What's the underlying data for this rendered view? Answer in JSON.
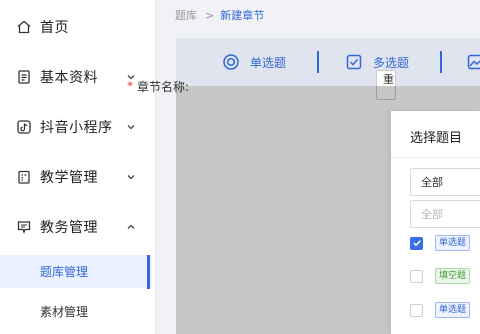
{
  "sidebar": {
    "items": [
      {
        "label": "首页",
        "icon": "home-icon"
      },
      {
        "label": "基本资料",
        "icon": "document-icon",
        "arrow": "chevron-down"
      },
      {
        "label": "抖音小程序",
        "icon": "tiktok-icon",
        "arrow": "chevron-down"
      },
      {
        "label": "教学管理",
        "icon": "clipboard-icon",
        "arrow": "chevron-down"
      },
      {
        "label": "教务管理",
        "icon": "comment-icon",
        "arrow": "chevron-up"
      }
    ],
    "sub_items": [
      {
        "label": "题库管理",
        "active": true
      },
      {
        "label": "素材管理",
        "active": false
      }
    ]
  },
  "breadcrumb": {
    "parent": "题库",
    "separator": ">",
    "current": "新建章节"
  },
  "toolbar": {
    "buttons": [
      {
        "label": "单选题",
        "icon": "radio-icon"
      },
      {
        "label": "多选题",
        "icon": "checkbox-icon"
      },
      {
        "label": "",
        "icon": "image-icon"
      }
    ]
  },
  "form": {
    "required_mark": "*",
    "chapter_label": "章节名称:",
    "chapter_value": "重"
  },
  "dialog": {
    "title": "选择题目",
    "filter_value": "全部",
    "filter2_placeholder": "全部",
    "questions": [
      {
        "checked": true,
        "tag": "单选题",
        "tag_color": "blue"
      },
      {
        "checked": false,
        "tag": "填空题",
        "tag_color": "green"
      },
      {
        "checked": false,
        "tag": "单选题",
        "tag_color": "blue"
      }
    ]
  },
  "colors": {
    "accent": "#3466d8",
    "required": "#e53935",
    "overlay": "rgba(0,0,0,0.22)"
  }
}
